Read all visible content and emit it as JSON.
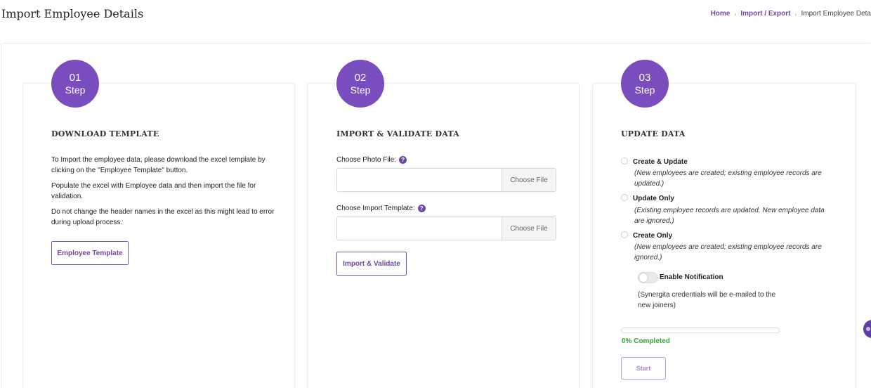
{
  "header": {
    "title": "Import Employee Details",
    "breadcrumb": [
      {
        "label": "Home"
      },
      {
        "label": "Import / Export"
      },
      {
        "label": "Import Employee Deta"
      }
    ]
  },
  "steps": [
    {
      "number": "01",
      "word": "Step",
      "heading": "DOWNLOAD TEMPLATE",
      "paragraphs": [
        "To Import the employee data, please download the excel template by clicking on the \"Employee Template\" button.",
        "Populate the excel with Employee data and then import the file for validation.",
        "Do not change the header names in the excel as this might lead to error during upload process."
      ],
      "button_label": "Employee Template"
    },
    {
      "number": "02",
      "word": "Step",
      "heading": "IMPORT & VALIDATE DATA",
      "photo_label": "Choose Photo File:",
      "template_label": "Choose Import Template:",
      "choose_file_label": "Choose File",
      "button_label": "Import & Validate"
    },
    {
      "number": "03",
      "word": "Step",
      "heading": "UPDATE DATA",
      "options": [
        {
          "label": "Create & Update",
          "note": "(New employees are created; existing employee records are updated.)"
        },
        {
          "label": "Update Only",
          "note": "(Existing employee records are updated. New employee data are ignored.)"
        },
        {
          "label": "Create Only",
          "note": "(New employees are created; existing employee records are ignored.)"
        }
      ],
      "notification_label": "Enable Notification",
      "notification_enabled": false,
      "notification_note": "(Synergita credentials will be e-mailed to the new joiners)",
      "progress_percent": 0,
      "progress_text": "0% Completed",
      "start_label": "Start"
    }
  ],
  "colors": {
    "accent": "#7a4dbf",
    "link": "#6b4aa5",
    "success": "#3aa33a"
  },
  "icons": {
    "help": "question-mark-circle",
    "breadcrumb_separator": "chevron-right"
  }
}
